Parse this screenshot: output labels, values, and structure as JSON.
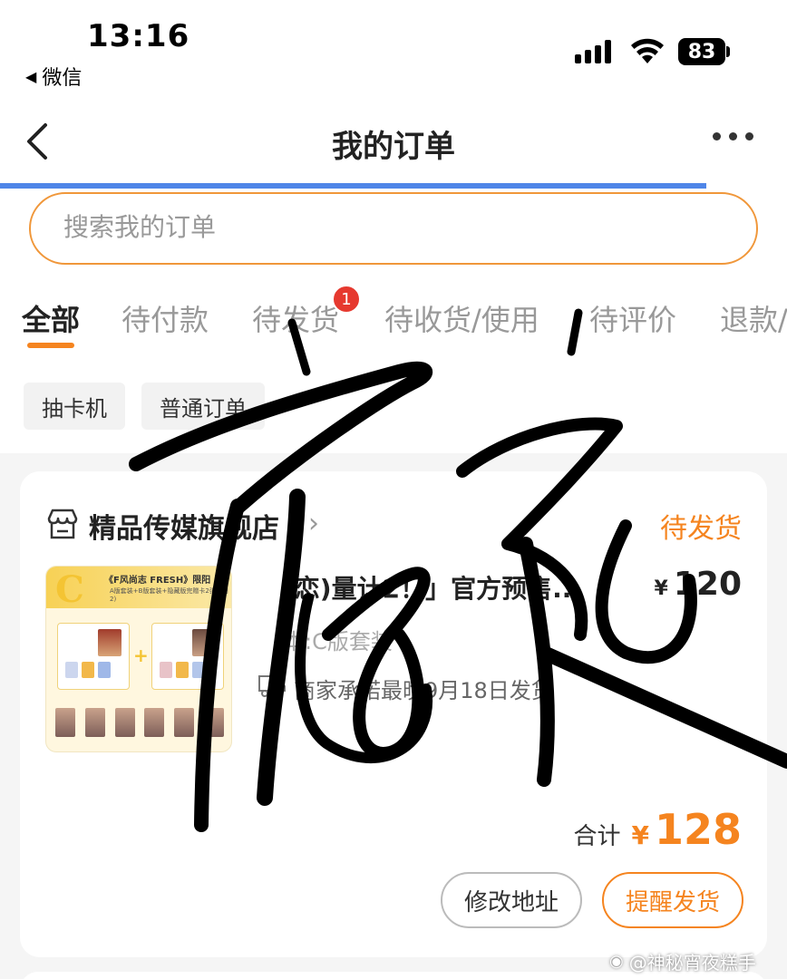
{
  "status_bar": {
    "time": "13:16",
    "back_app": "微信",
    "battery": "83"
  },
  "nav": {
    "title": "我的订单"
  },
  "search": {
    "placeholder": "搜索我的订单"
  },
  "tabs": [
    {
      "label": "全部",
      "active": true
    },
    {
      "label": "待付款"
    },
    {
      "label": "待发货",
      "badge": "1"
    },
    {
      "label": "待收货/使用"
    },
    {
      "label": "待评价"
    },
    {
      "label": "退款/"
    }
  ],
  "filter_chips": [
    "抽卡机",
    "普通订单"
  ],
  "order": {
    "shop_name": "精品传媒旗舰店",
    "status": "待发货",
    "product_title": "(恋)量计2！」官方预售...",
    "currency": "¥",
    "price": "120",
    "spec": "本:C版套装",
    "shipping_note": "商家承诺最晚9月18日发货",
    "total_label": "合计",
    "total_amount": "128",
    "buttons": {
      "modify_address": "修改地址",
      "remind_shipping": "提醒发货"
    },
    "thumbnail": {
      "letter": "C",
      "title": "《F风尚志 FRESH》限阳",
      "subtitle": "A版套装+B版套装+隐藏版完赠卡2张(5周2)"
    }
  },
  "watermark": "@神秘宵夜糕手",
  "colors": {
    "accent_orange": "#f5841f",
    "badge_red": "#e6392f",
    "progress_blue": "#4f86e8"
  }
}
